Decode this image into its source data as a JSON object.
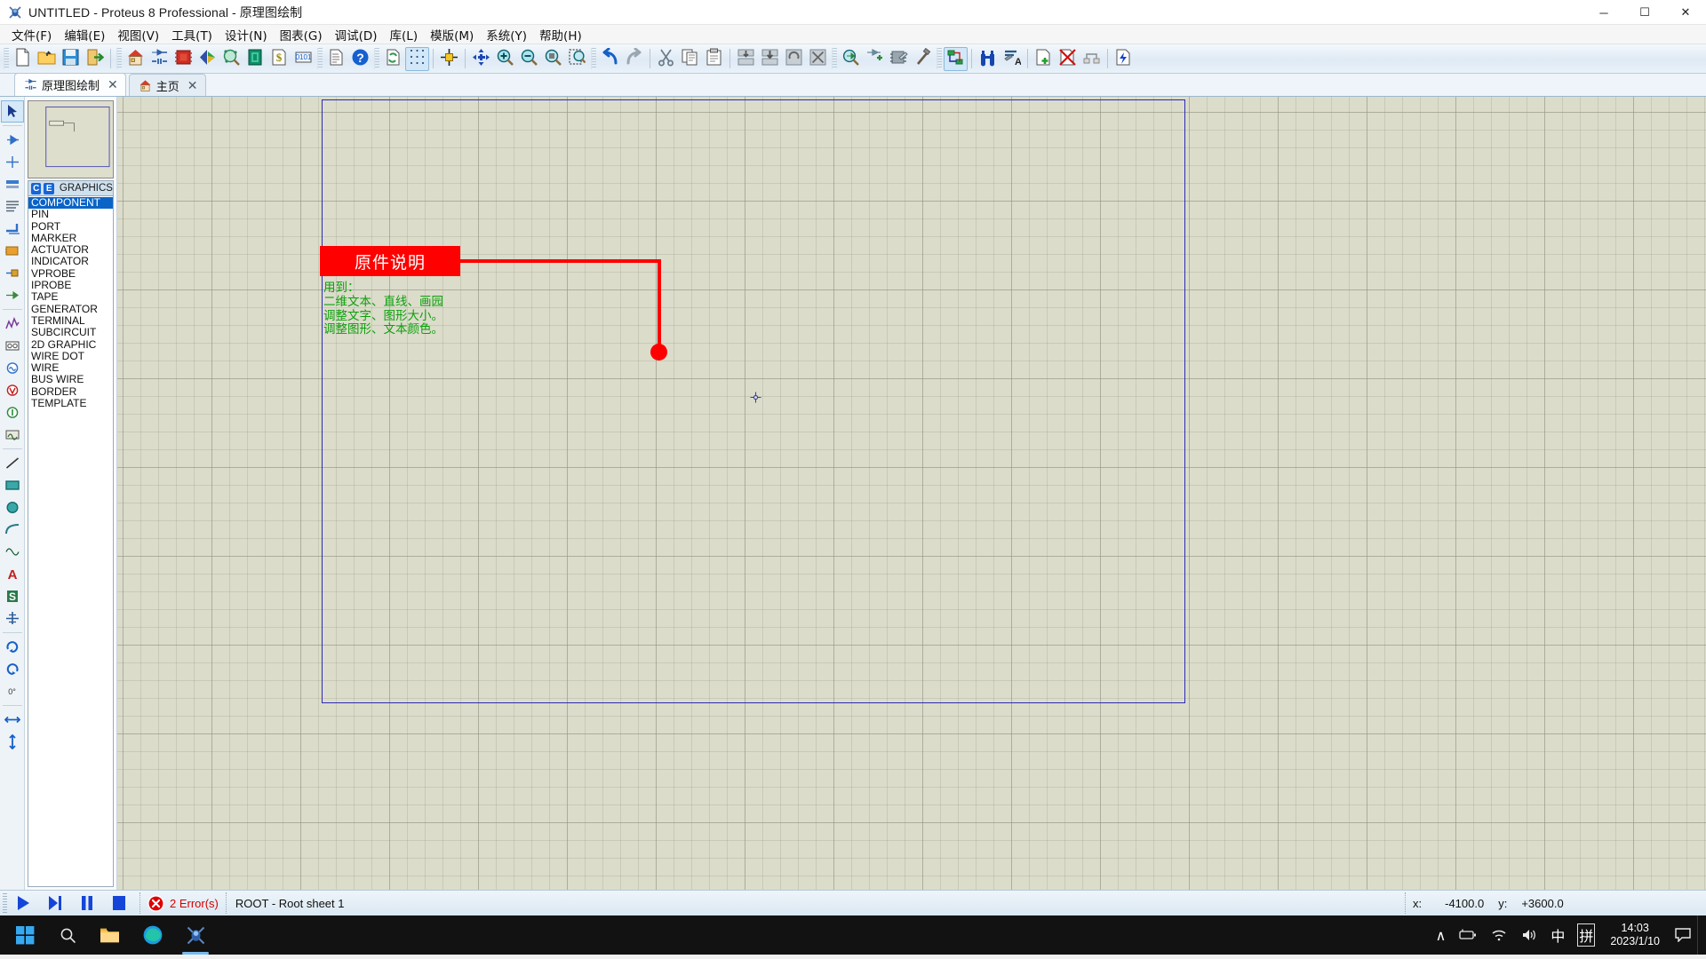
{
  "window": {
    "title": "UNTITLED - Proteus 8 Professional - 原理图绘制",
    "app_icon": "proteus-bug-icon",
    "minimize": "─",
    "maximize": "☐",
    "close": "✕"
  },
  "menubar": {
    "items": [
      {
        "label": "文件(F)",
        "name": "menu-file"
      },
      {
        "label": "编辑(E)",
        "name": "menu-edit"
      },
      {
        "label": "视图(V)",
        "name": "menu-view"
      },
      {
        "label": "工具(T)",
        "name": "menu-tools"
      },
      {
        "label": "设计(N)",
        "name": "menu-design"
      },
      {
        "label": "图表(G)",
        "name": "menu-graph"
      },
      {
        "label": "调试(D)",
        "name": "menu-debug"
      },
      {
        "label": "库(L)",
        "name": "menu-library"
      },
      {
        "label": "模版(M)",
        "name": "menu-template"
      },
      {
        "label": "系统(Y)",
        "name": "menu-system"
      },
      {
        "label": "帮助(H)",
        "name": "menu-help"
      }
    ]
  },
  "toolbar": {
    "groups": [
      {
        "name": "file-group",
        "buttons": [
          {
            "icon": "new-file-icon",
            "name": "new-design-button"
          },
          {
            "icon": "open-folder-icon",
            "name": "open-design-button"
          },
          {
            "icon": "save-floppy-icon",
            "name": "save-design-button"
          },
          {
            "icon": "exit-door-icon",
            "name": "close-design-button"
          }
        ]
      },
      {
        "name": "module-group",
        "buttons": [
          {
            "icon": "home-icon",
            "name": "home-page-button"
          },
          {
            "icon": "schematic-capture-icon",
            "name": "schematic-capture-button"
          },
          {
            "icon": "pcb-layout-icon",
            "name": "pcb-layout-button"
          },
          {
            "icon": "3d-viewer-icon",
            "name": "3d-visualizer-button"
          },
          {
            "icon": "design-explorer-icon",
            "name": "design-explorer-button"
          },
          {
            "icon": "bom-icon",
            "name": "bill-of-materials-button"
          },
          {
            "icon": "dollar-sheet-icon",
            "name": "project-cost-button"
          },
          {
            "icon": "binary-icon",
            "name": "source-code-button"
          }
        ]
      },
      {
        "name": "report-group",
        "buttons": [
          {
            "icon": "report-icon",
            "name": "netlist-report-button"
          },
          {
            "icon": "help-question-icon",
            "name": "help-button"
          }
        ]
      },
      {
        "name": "view-group",
        "buttons": [
          {
            "icon": "redraw-icon",
            "name": "redraw-view-button"
          },
          {
            "icon": "grid-dots-icon",
            "name": "toggle-grid-button",
            "state": "on"
          },
          {
            "icon": "origin-icon",
            "name": "set-origin-button"
          },
          {
            "icon": "pan-arrows-icon",
            "name": "pan-button"
          },
          {
            "icon": "zoom-in-icon",
            "name": "zoom-in-button"
          },
          {
            "icon": "zoom-out-icon",
            "name": "zoom-out-button"
          },
          {
            "icon": "zoom-all-icon",
            "name": "zoom-to-view-all-button"
          },
          {
            "icon": "zoom-area-icon",
            "name": "zoom-to-area-button"
          }
        ]
      },
      {
        "name": "edit-group",
        "buttons": [
          {
            "icon": "undo-icon",
            "name": "undo-button"
          },
          {
            "icon": "redo-icon",
            "name": "redo-button"
          },
          {
            "icon": "cut-scissors-icon",
            "name": "cut-button"
          },
          {
            "icon": "copy-icon",
            "name": "copy-button"
          },
          {
            "icon": "paste-icon",
            "name": "paste-button"
          },
          {
            "icon": "block-copy-icon",
            "name": "block-copy-button"
          },
          {
            "icon": "block-move-icon",
            "name": "block-move-button"
          },
          {
            "icon": "block-rotate-icon",
            "name": "block-rotate-button"
          },
          {
            "icon": "block-delete-icon",
            "name": "block-delete-button"
          }
        ]
      },
      {
        "name": "library-group",
        "buttons": [
          {
            "icon": "pick-device-icon",
            "name": "pick-from-libraries-button"
          },
          {
            "icon": "make-device-icon",
            "name": "make-device-button"
          },
          {
            "icon": "package-tool-icon",
            "name": "packaging-tool-button"
          },
          {
            "icon": "decompose-icon",
            "name": "decompose-button"
          }
        ]
      },
      {
        "name": "tool-group",
        "buttons": [
          {
            "icon": "wire-autorouter-icon",
            "name": "wire-autorouter-button",
            "state": "on"
          },
          {
            "icon": "search-binoculars-icon",
            "name": "search-and-tag-button"
          },
          {
            "icon": "property-assign-icon",
            "name": "property-assignment-button"
          },
          {
            "icon": "new-sheet-icon",
            "name": "new-sheet-button"
          },
          {
            "icon": "remove-sheet-icon",
            "name": "remove-sheet-button"
          },
          {
            "icon": "sheet-hierarchy-icon",
            "name": "exit-sub-sheet-button"
          },
          {
            "icon": "netlist-icon",
            "name": "generate-netlist-button"
          }
        ]
      }
    ]
  },
  "tabs": [
    {
      "label": "原理图绘制",
      "icon": "schematic-capture-icon",
      "close": "✕",
      "active": true
    },
    {
      "label": "主页",
      "icon": "home-icon",
      "close": "✕",
      "active": false
    }
  ],
  "toolrail": {
    "items": [
      {
        "name": "selection-mode",
        "icon": "arrow-cursor-icon",
        "state": "on"
      },
      {
        "name": "component-mode",
        "icon": "component-icon"
      },
      {
        "name": "junction-dot-mode",
        "icon": "junction-dot-icon"
      },
      {
        "name": "wire-label-mode",
        "icon": "wire-label-icon"
      },
      {
        "name": "text-script-mode",
        "icon": "text-script-icon"
      },
      {
        "name": "bus-mode",
        "icon": "bus-icon"
      },
      {
        "name": "subcircuit-mode",
        "icon": "subcircuit-icon"
      },
      {
        "name": "terminals-mode",
        "icon": "terminal-icon"
      },
      {
        "name": "device-pin-mode",
        "icon": "device-pin-icon"
      },
      {
        "name": "graph-mode",
        "icon": "graph-icon"
      },
      {
        "name": "tape-recorder-mode",
        "icon": "tape-recorder-icon"
      },
      {
        "name": "generator-mode",
        "icon": "generator-icon"
      },
      {
        "name": "voltage-probe-mode",
        "icon": "voltage-probe-icon"
      },
      {
        "name": "current-probe-mode",
        "icon": "current-probe-icon"
      },
      {
        "name": "virtual-instrument-mode",
        "icon": "instrument-icon"
      },
      {
        "name": "2d-line-mode",
        "icon": "line-icon"
      },
      {
        "name": "2d-box-mode",
        "icon": "box-icon"
      },
      {
        "name": "2d-circle-mode",
        "icon": "circle-icon"
      },
      {
        "name": "2d-arc-mode",
        "icon": "arc-icon"
      },
      {
        "name": "2d-path-mode",
        "icon": "path-icon"
      },
      {
        "name": "2d-text-mode",
        "icon": "text-a-icon"
      },
      {
        "name": "2d-symbol-mode",
        "icon": "symbol-s-icon"
      },
      {
        "name": "2d-marker-mode",
        "icon": "marker-cross-icon"
      },
      {
        "name": "rotate-clockwise",
        "icon": "rotate-cw-icon"
      },
      {
        "name": "rotate-anticlockwise",
        "icon": "rotate-ccw-icon"
      },
      {
        "name": "rotation-angle",
        "icon": "angle-value",
        "label": "0°"
      },
      {
        "name": "mirror-horizontal",
        "icon": "mirror-x-icon"
      },
      {
        "name": "mirror-vertical",
        "icon": "mirror-y-icon"
      }
    ]
  },
  "object_selector": {
    "header": {
      "c_badge": "C",
      "e_badge": "E",
      "title": "GRAPHICS"
    },
    "items": [
      "COMPONENT",
      "PIN",
      "PORT",
      "MARKER",
      "ACTUATOR",
      "INDICATOR",
      "VPROBE",
      "IPROBE",
      "TAPE",
      "GENERATOR",
      "TERMINAL",
      "SUBCIRCUIT",
      "2D GRAPHIC",
      "WIRE DOT",
      "WIRE",
      "BUS WIRE",
      "BORDER",
      "TEMPLATE"
    ],
    "selected_index": 0
  },
  "canvas": {
    "title_box": {
      "text": "原件说明",
      "fill_color": "#ff0000",
      "text_color": "#ffffff"
    },
    "notes": [
      "用到：",
      "二维文本、直线、画园",
      "调整文字、图形大小。",
      "调整图形、文本颜色。"
    ],
    "notes_color": "#0aa00a",
    "sheet_border_color": "#2b2bb5",
    "annotation_color": "#ff0000",
    "cursor_icon": "crosshair-cursor-icon"
  },
  "statusbar": {
    "animate_buttons": [
      {
        "name": "play-button",
        "icon": "play-icon"
      },
      {
        "name": "step-button",
        "icon": "step-icon"
      },
      {
        "name": "pause-button",
        "icon": "pause-icon"
      },
      {
        "name": "stop-button",
        "icon": "stop-icon"
      }
    ],
    "error_icon": "error-circle-icon",
    "error_text": "2 Error(s)",
    "sheet_text": "ROOT - Root sheet 1",
    "coord_x_label": "x:",
    "coord_x_value": "-4100.0",
    "coord_y_label": "y:",
    "coord_y_value": "+3600.0"
  },
  "taskbar": {
    "start": {
      "name": "start-button",
      "icon": "windows-logo-icon"
    },
    "buttons": [
      {
        "name": "search-button",
        "icon": "search-icon"
      },
      {
        "name": "file-explorer-button",
        "icon": "folder-icon"
      },
      {
        "name": "edge-browser-button",
        "icon": "edge-icon"
      },
      {
        "name": "proteus-taskbar-button",
        "icon": "proteus-bug-icon",
        "active": true
      }
    ],
    "tray": [
      {
        "name": "show-hidden-icons",
        "icon": "chevron-up-icon",
        "glyph": "∧"
      },
      {
        "name": "battery-icon",
        "icon": "battery-icon"
      },
      {
        "name": "wifi-icon",
        "icon": "wifi-icon"
      },
      {
        "name": "volume-icon",
        "icon": "speaker-icon"
      },
      {
        "name": "ime-mode-indicator",
        "icon": "ime-chinese-icon",
        "glyph": "中"
      },
      {
        "name": "ime-pinyin-indicator",
        "icon": "ime-pinyin-icon",
        "glyph": "拼"
      }
    ],
    "clock": {
      "time": "14:03",
      "date": "2023/1/10"
    },
    "notification": {
      "name": "notification-center-button",
      "icon": "speech-bubble-icon"
    }
  }
}
